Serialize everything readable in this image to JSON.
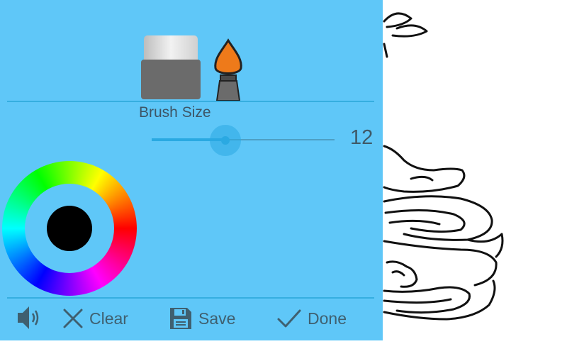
{
  "tools": {
    "eraser_icon": "eraser-icon",
    "brush_icon": "paintbrush-icon"
  },
  "brush_size": {
    "label": "Brush Size",
    "value": "12",
    "slider_min": 1,
    "slider_max": 30
  },
  "color_wheel": {
    "selected_color": "#000000"
  },
  "bottom_bar": {
    "sound_icon": "speaker-icon",
    "clear_label": "Clear",
    "save_label": "Save",
    "done_label": "Done"
  },
  "colors": {
    "panel_bg": "#5fc7f8",
    "accent": "#36aee0",
    "brush_tip": "#ee7a1a"
  }
}
